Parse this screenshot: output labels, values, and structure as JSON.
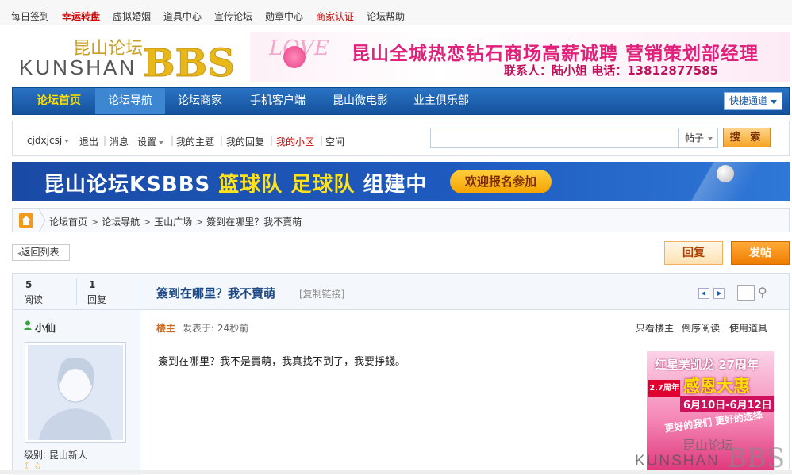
{
  "topbar": {
    "links": [
      "每日签到",
      "幸运转盘",
      "虚拟婚姻",
      "道具中心",
      "宣传论坛",
      "勋章中心",
      "商家认证",
      "论坛帮助"
    ]
  },
  "logo": {
    "cn": "昆山论坛",
    "en": "KUNSHAN",
    "bbs": "BBS"
  },
  "banner_top": {
    "line1": "昆山全城热恋钻石商场高薪诚聘 营销策划部经理",
    "line2": "联系人：陆小姐  电话：13812877585",
    "decor": "LOVE"
  },
  "nav": {
    "items": [
      "论坛首页",
      "论坛导航",
      "论坛商家",
      "手机客户端",
      "昆山微电影",
      "业主俱乐部"
    ],
    "quick": "快捷通道"
  },
  "userbar": {
    "username": "cjdxjcsj",
    "logout": "退出",
    "messages": "消息",
    "settings": "设置",
    "my_topics": "我的主题",
    "my_replies": "我的回复",
    "my_community": "我的小区",
    "space": "空间",
    "search_type": "帖子",
    "search_button": "搜 索"
  },
  "banner_mid": {
    "text_prefix": "昆山论坛KSBBS ",
    "text_highlight": "篮球队 足球队",
    "text_suffix": " 组建中",
    "button": "欢迎报名参加"
  },
  "breadcrumb": {
    "items": [
      "论坛首页",
      "论坛导航",
      "玉山广场",
      "簽到在哪里？我不賣萌"
    ]
  },
  "actions": {
    "back": "返回列表",
    "reply": "回复",
    "post": "发帖"
  },
  "thread": {
    "views_count": "5",
    "views_label": "阅读",
    "replies_count": "1",
    "replies_label": "回复",
    "title": "簽到在哪里？我不賣萌",
    "copy_link": "[复制链接]"
  },
  "post": {
    "author": "小仙",
    "level": "级别: 昆山新人",
    "floor": "楼主",
    "posted": "发表于: 24秒前",
    "tools": [
      "只看楼主",
      "倒序阅读",
      "使用道具"
    ],
    "content": "簽到在哪里？我不是賣萌，我真找不到了，我要掙錢。"
  },
  "ad": {
    "line1": "红星美凯龙 27周年",
    "line2": "感恩大惠",
    "line3": "6月10日-6月12日",
    "line4": "更好的我们 更好的选择",
    "badge": "2.7周年"
  },
  "watermark": {
    "cn": "昆山论坛",
    "en": "KUNSHAN",
    "bbs": "BBS"
  }
}
